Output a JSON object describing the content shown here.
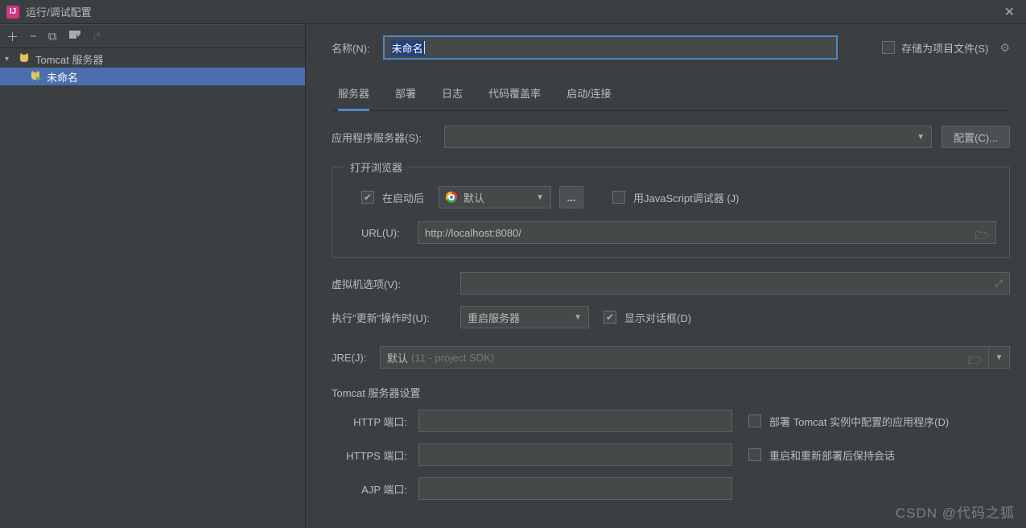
{
  "window": {
    "title": "运行/调试配置"
  },
  "toolbar_icons": {
    "add": "＋",
    "remove": "−",
    "copy": "⧉",
    "save": "📁",
    "sort": "↓²"
  },
  "tree": {
    "root": {
      "label": "Tomcat 服务器"
    },
    "child": {
      "label": "未命名"
    }
  },
  "header": {
    "name_label": "名称(N):",
    "name_value": "未命名",
    "store_label": "存储为项目文件(S)"
  },
  "tabs": [
    "服务器",
    "部署",
    "日志",
    "代码覆盖率",
    "启动/连接"
  ],
  "server": {
    "app_server_label": "应用程序服务器(S):",
    "app_server_value": "",
    "configure_btn": "配置(C)...",
    "browser_group": "打开浏览器",
    "after_launch_label": "在启动后",
    "browser_value": "默认",
    "dots": "...",
    "js_debugger_label": "用JavaScript调试器 (J)",
    "url_label": "URL(U):",
    "url_value": "http://localhost:8080/",
    "vm_label": "虚拟机选项(V):",
    "vm_value": "",
    "update_label": "执行\"更新\"操作时(U):",
    "update_value": "重启服务器",
    "show_dialog_label": "显示对话框(D)",
    "jre_label": "JRE(J):",
    "jre_prefix": "默认",
    "jre_hint": "(11 - project SDK)"
  },
  "tomcat": {
    "section": "Tomcat 服务器设置",
    "http_label": "HTTP 端口:",
    "https_label": "HTTPS 端口:",
    "ajp_label": "AJP 端口:",
    "deploy_label": "部署 Tomcat 实例中配置的应用程序(D)",
    "preserve_label": "重启和重新部署后保持会话"
  },
  "watermark": "CSDN @代码之狐"
}
